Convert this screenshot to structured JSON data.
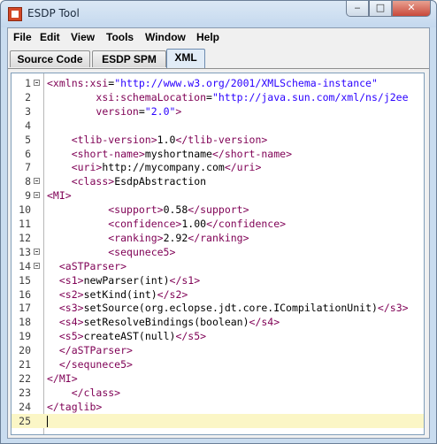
{
  "window": {
    "title": "ESDP Tool",
    "minimize_glyph": "‒",
    "maximize_glyph": "□",
    "close_glyph": "✕"
  },
  "menu": [
    "File",
    "Edit",
    "View",
    "Tools",
    "Window",
    "Help"
  ],
  "tabs": [
    {
      "label": "Source Code",
      "active": false
    },
    {
      "label": "ESDP SPM",
      "active": false
    },
    {
      "label": "XML",
      "active": true
    }
  ],
  "editor": {
    "current_line": 25,
    "lines": [
      {
        "n": "1",
        "fold": true,
        "code": "<xmlns:xsi=\"http://www.w3.org/2001/XMLSchema-instance\""
      },
      {
        "n": "2",
        "fold": false,
        "code": "        xsi:schemaLocation=\"http://java.sun.com/xml/ns/j2ee"
      },
      {
        "n": "3",
        "fold": false,
        "code": "        version=\"2.0\">"
      },
      {
        "n": "4",
        "fold": false,
        "code": ""
      },
      {
        "n": "5",
        "fold": false,
        "code": "    <tlib-version>1.0</tlib-version>"
      },
      {
        "n": "6",
        "fold": false,
        "code": "    <short-name>myshortname</short-name>"
      },
      {
        "n": "7",
        "fold": false,
        "code": "    <uri>http://mycompany.com</uri>"
      },
      {
        "n": "8",
        "fold": true,
        "code": "    <class>EsdpAbstraction"
      },
      {
        "n": "9",
        "fold": true,
        "code": "<MI>"
      },
      {
        "n": "10",
        "fold": false,
        "code": "          <support>0.58</support>"
      },
      {
        "n": "11",
        "fold": false,
        "code": "          <confidence>1.00</confidence>"
      },
      {
        "n": "12",
        "fold": false,
        "code": "          <ranking>2.92</ranking>"
      },
      {
        "n": "13",
        "fold": true,
        "code": "          <sequnece5>"
      },
      {
        "n": "14",
        "fold": true,
        "code": "  <aSTParser>"
      },
      {
        "n": "15",
        "fold": false,
        "code": "  <s1>newParser(int)</s1>"
      },
      {
        "n": "16",
        "fold": false,
        "code": "  <s2>setKind(int)</s2>"
      },
      {
        "n": "17",
        "fold": false,
        "code": "  <s3>setSource(org.eclopse.jdt.core.ICompilationUnit)</s3>"
      },
      {
        "n": "18",
        "fold": false,
        "code": "  <s4>setResolveBindings(boolean)</s4>"
      },
      {
        "n": "19",
        "fold": false,
        "code": "  <s5>createAST(null)</s5>"
      },
      {
        "n": "20",
        "fold": false,
        "code": "  </aSTParser>"
      },
      {
        "n": "21",
        "fold": false,
        "code": "  </sequnece5>"
      },
      {
        "n": "22",
        "fold": false,
        "code": "</MI>"
      },
      {
        "n": "23",
        "fold": false,
        "code": "    </class>"
      },
      {
        "n": "24",
        "fold": false,
        "code": "</taglib>"
      },
      {
        "n": "25",
        "fold": false,
        "code": ""
      }
    ]
  },
  "colors": {
    "tag": "#7f0055",
    "value": "#2a00ff",
    "current_line": "#fbf6c6"
  }
}
